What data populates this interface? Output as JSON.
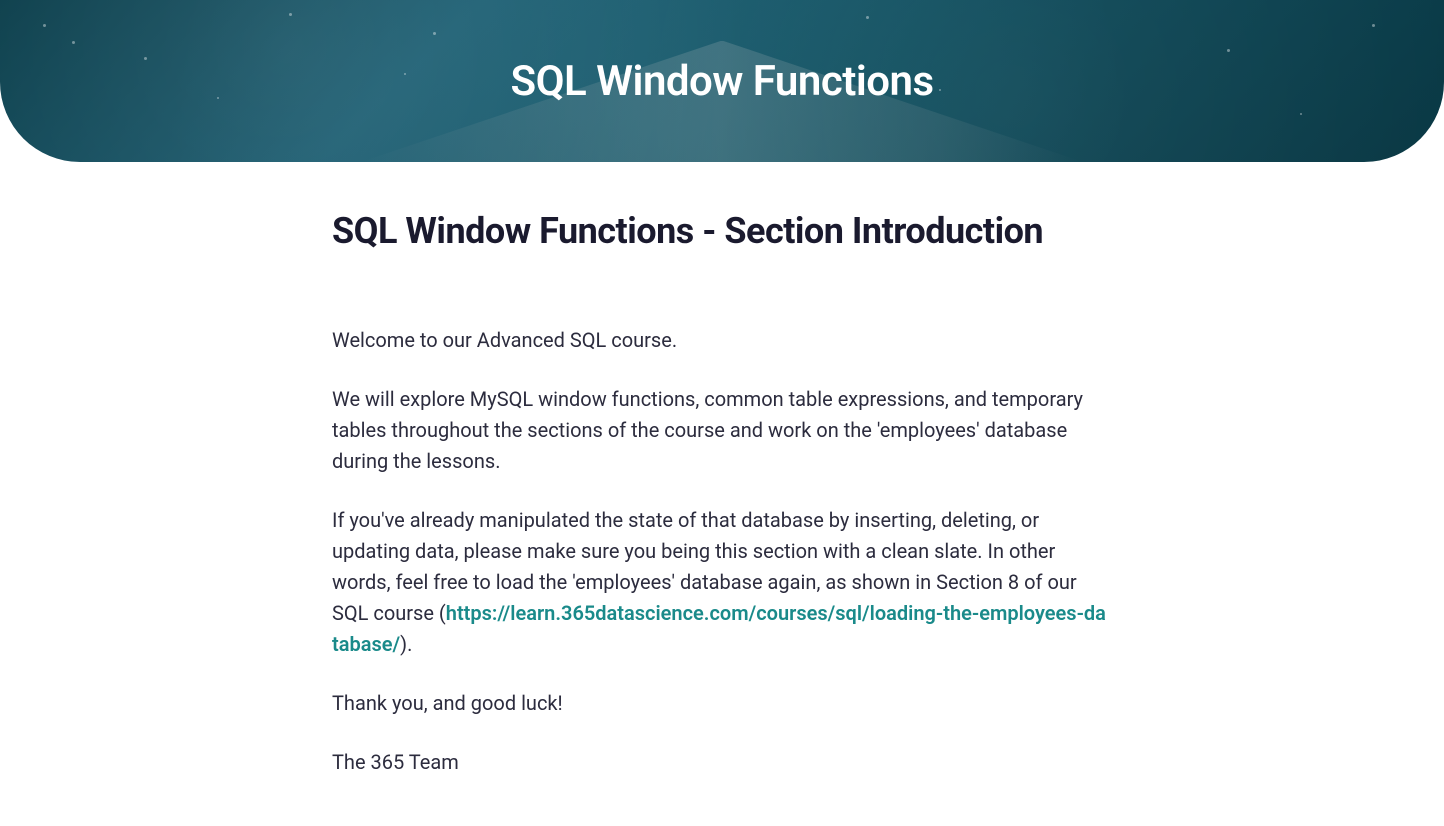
{
  "hero": {
    "title": "SQL Window Functions"
  },
  "section": {
    "title": "SQL Window Functions - Section Introduction"
  },
  "paragraphs": {
    "p1": "Welcome to our Advanced SQL course.",
    "p2": "We will explore MySQL window functions, common table expressions, and temporary tables throughout the sections of the course and work on the 'employees' database during the lessons.",
    "p3_before": "If you've already manipulated the state of that database by inserting, deleting, or updating data, please make sure you being this section with a clean slate. In other words, feel free to load the 'employees' database again, as shown in Section 8 of our SQL course (",
    "p3_link_text": "https://learn.365datascience.com/courses/sql/loading-the-employees-database/",
    "p3_link_href": "https://learn.365datascience.com/courses/sql/loading-the-employees-database/",
    "p3_after": ").",
    "p4": "Thank you, and good luck!",
    "p5": "The 365 Team"
  }
}
